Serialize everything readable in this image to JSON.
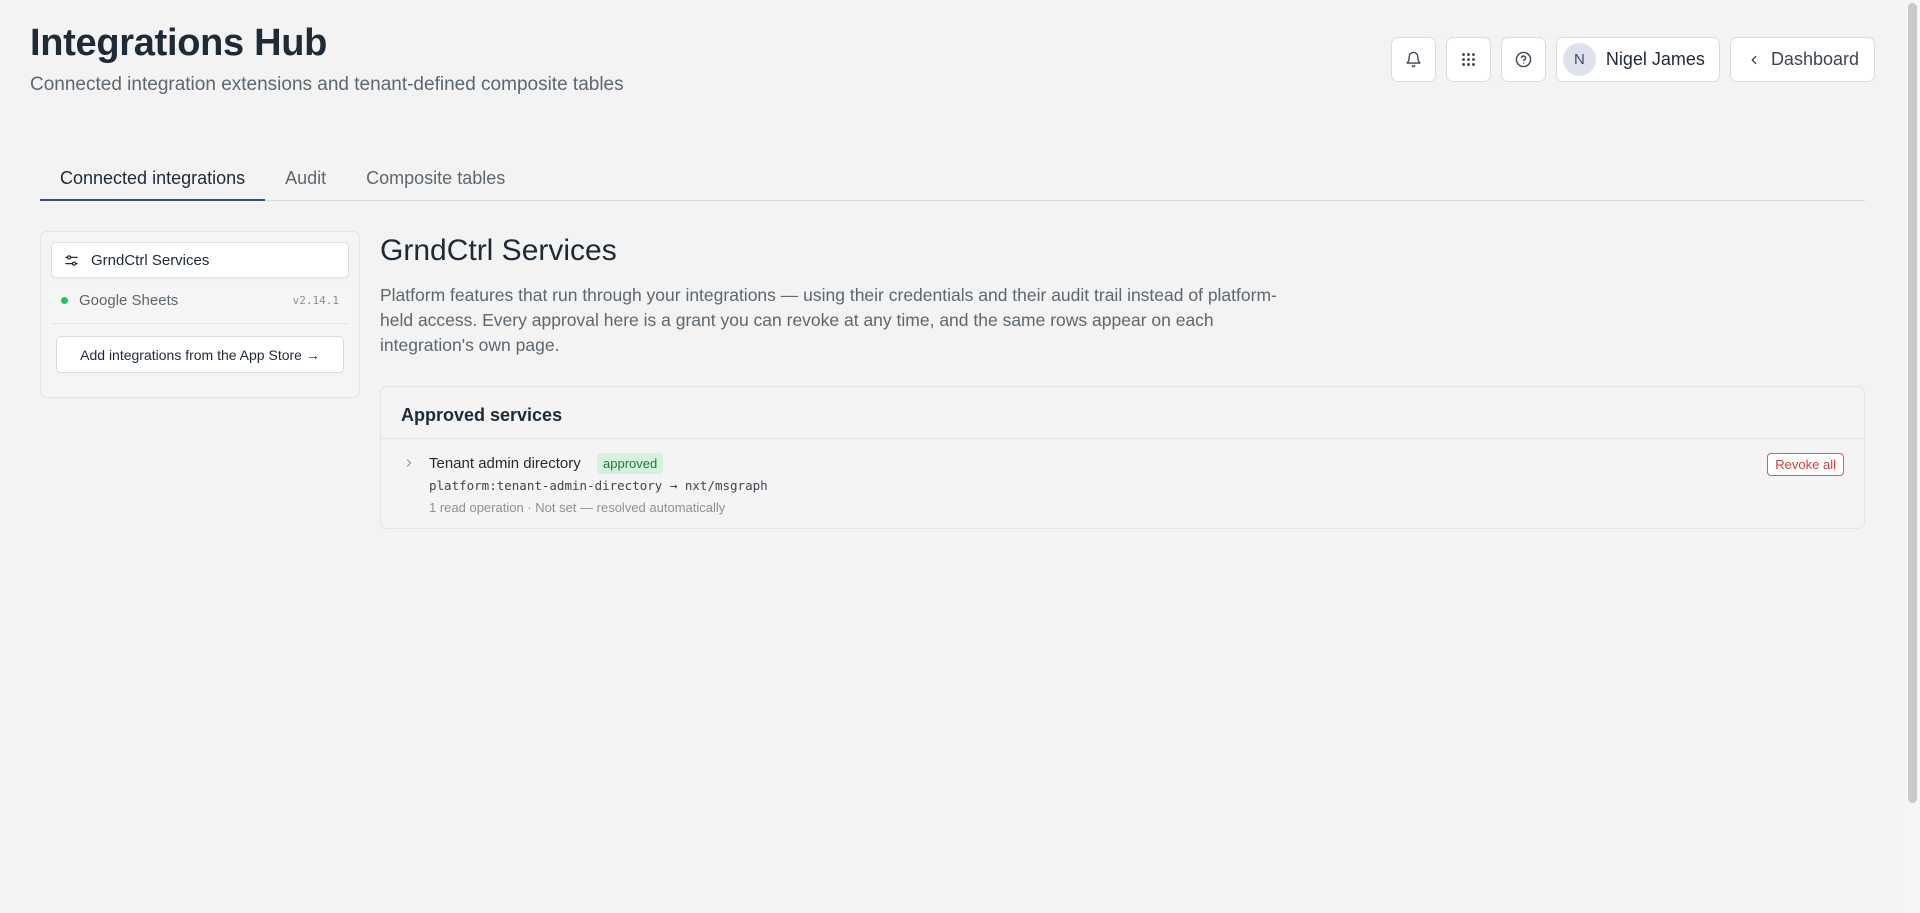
{
  "header": {
    "title": "Integrations Hub",
    "subtitle": "Connected integration extensions and tenant-defined composite tables"
  },
  "top_actions": {
    "icons": [
      "bell-icon",
      "apps-grid-icon",
      "help-icon"
    ],
    "user": {
      "initial": "N",
      "name": "Nigel James"
    },
    "dashboard_label": "Dashboard"
  },
  "tabs": [
    {
      "label": "Connected integrations",
      "active": true
    },
    {
      "label": "Audit",
      "active": false
    },
    {
      "label": "Composite tables",
      "active": false
    }
  ],
  "sidebar": {
    "active_item": {
      "label": "GrndCtrl Services",
      "icon": "sliders-icon"
    },
    "items": [
      {
        "label": "Google Sheets",
        "version": "v2.14.1",
        "status_color": "#22c55e"
      }
    ],
    "add_button": "Add integrations from the App Store →"
  },
  "main": {
    "title": "GrndCtrl Services",
    "description": "Platform features that run through your integrations — using their credentials and their audit trail instead of platform-held access. Every approval here is a grant you can revoke at any time, and the same rows appear on each integration's own page.",
    "card": {
      "heading": "Approved services",
      "services": [
        {
          "name": "Tenant admin directory",
          "badge": "approved",
          "mapping": "platform:tenant-admin-directory → nxt/msgraph",
          "meta": "1 read operation · Not set — resolved automatically",
          "revoke_label": "Revoke all"
        }
      ]
    }
  },
  "colors": {
    "accent_tab": "#34507a",
    "approved_bg": "#d6f2dd",
    "revoke_red": "#d43c3c",
    "status_green": "#22c55e"
  }
}
